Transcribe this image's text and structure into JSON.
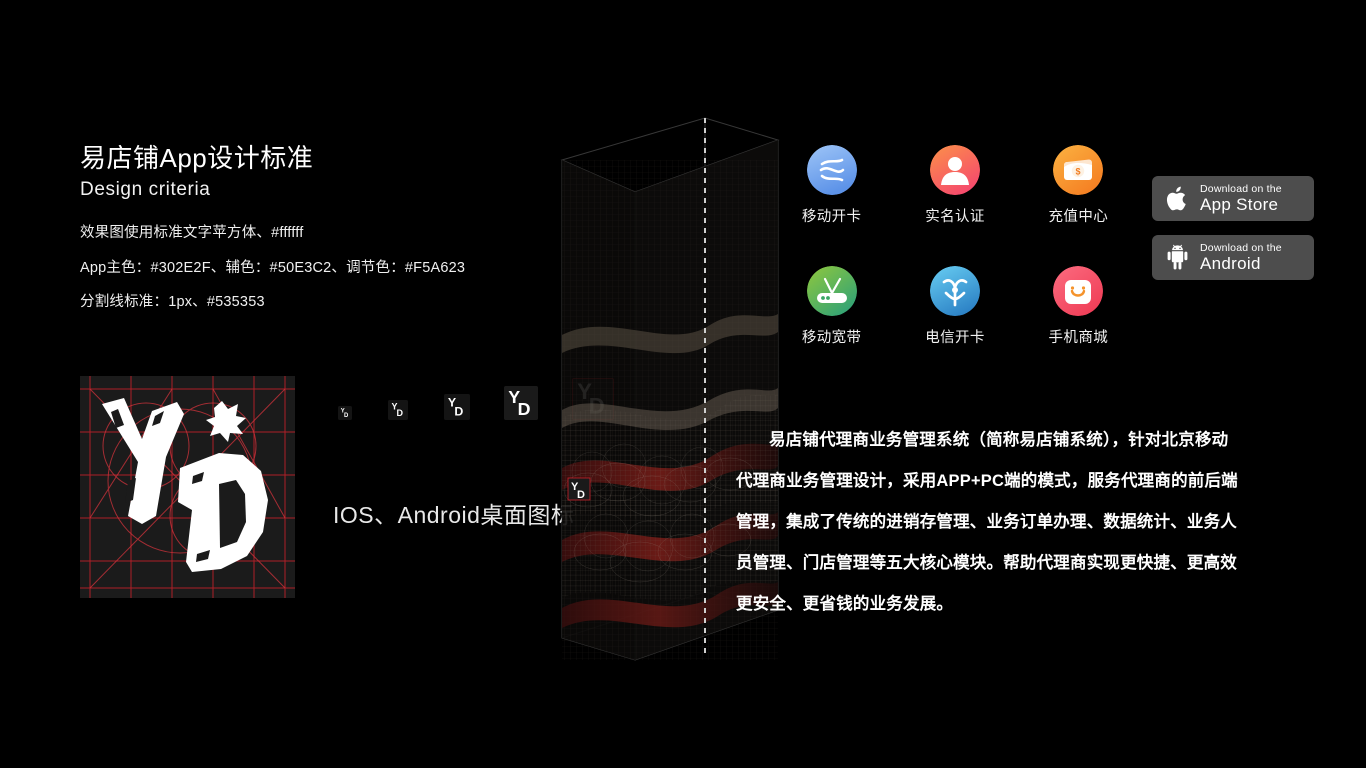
{
  "heading": {
    "title_cn": "易店铺App设计标准",
    "title_en": "Design criteria"
  },
  "specs": [
    "效果图使用标准文字苹方体、#ffffff",
    "App主色：#302E2F、辅色：#50E3C2、调节色：#F5A623",
    "分割线标准：1px、#535353"
  ],
  "colors": {
    "app_primary": "#302E2F",
    "app_secondary": "#50E3C2",
    "app_accent": "#F5A623",
    "text_white": "#ffffff",
    "divider": "#535353",
    "logo_grid_red": "#c8202a",
    "badge_bg": "#4d4d4d"
  },
  "logo": {
    "name": "yd-brand-logo",
    "letters": "YD"
  },
  "icon_ramp": {
    "caption": "IOS、Android桌面图标",
    "sizes": [
      14,
      20,
      26,
      34,
      42
    ]
  },
  "app_icons": [
    {
      "label": "移动开卡",
      "icon": "china-mobile-icon",
      "color": "#7eb0f2"
    },
    {
      "label": "实名认证",
      "icon": "person-verify-icon",
      "color": "#f76a78"
    },
    {
      "label": "充值中心",
      "icon": "wallet-dollar-icon",
      "color": "#f79433"
    },
    {
      "label": "移动宽带",
      "icon": "router-wifi-icon",
      "color": "#62b85c"
    },
    {
      "label": "电信开卡",
      "icon": "china-telecom-icon",
      "color": "#4fa8dd"
    },
    {
      "label": "手机商城",
      "icon": "shopping-bag-icon",
      "color": "#f4636f"
    }
  ],
  "badges": [
    {
      "icon": "apple-icon",
      "small": "Download on the",
      "large": "App Store"
    },
    {
      "icon": "android-icon",
      "small": "Download on the",
      "large": "Android"
    }
  ],
  "description_lines": [
    "易店铺代理商业务管理系统（简称易店铺系统），针对北京移动",
    "代理商业务管理设计，采用APP+PC端的模式，服务代理商的前后端",
    "管理，集成了传统的进销存管理、业务订单办理、数据统计、业务人",
    "员管理、门店管理等五大核心模块。帮助代理商实现更快捷、更高效",
    "更安全、更省钱的业务发展。"
  ]
}
